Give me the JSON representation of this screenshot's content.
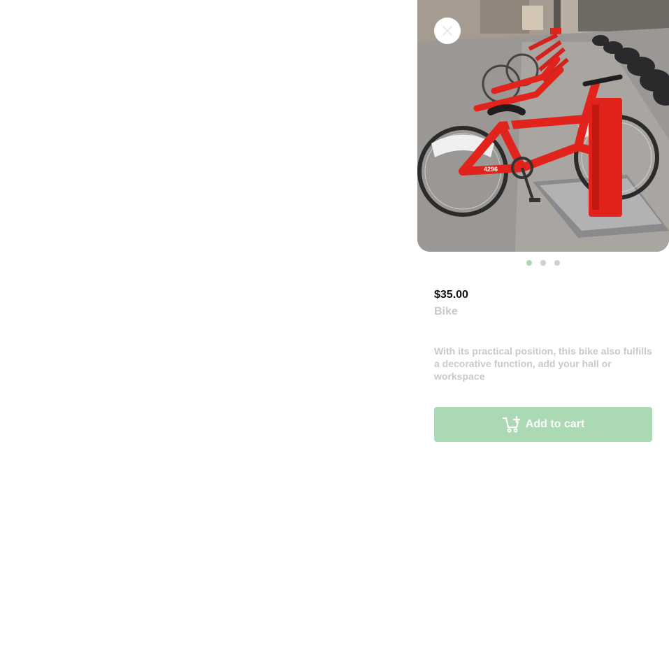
{
  "product": {
    "price": "$35.00",
    "name": "Bike",
    "description": "With its practical position, this bike also fulfills a decorative function, add your hall or workspace",
    "image_alt": "Row of red shared bicycles docked at a city bike station"
  },
  "carousel": {
    "slide_count": 3,
    "active_index": 0
  },
  "actions": {
    "close_icon": "close-icon",
    "add_to_cart_label": "Add to cart",
    "add_to_cart_icon": "cart-plus-icon"
  },
  "colors": {
    "accent": "#abd9b3",
    "price_text": "#111111",
    "muted_text": "#c9c9c9",
    "dot_inactive": "#cfcfcf",
    "bike_red": "#e1231c"
  }
}
